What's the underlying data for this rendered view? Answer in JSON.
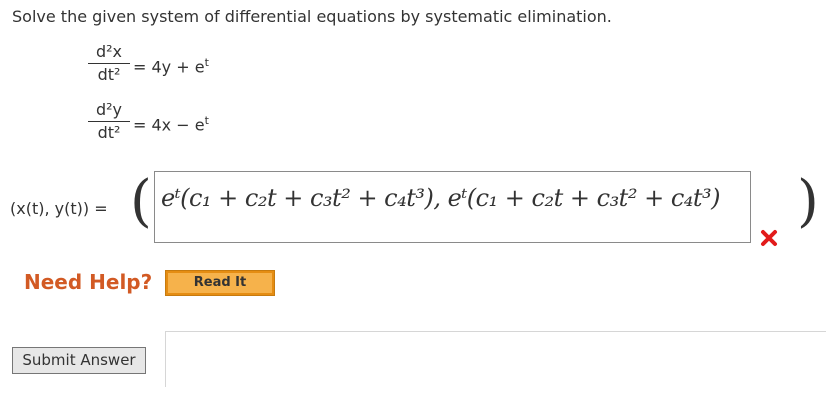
{
  "question": "Solve the given system of differential equations by systematic elimination.",
  "eq1": {
    "num": "d²x",
    "den": "dt²",
    "eq": "=",
    "rhs_a": "4y",
    "op": "+",
    "rhs_b": "e",
    "sup": "t"
  },
  "eq2": {
    "num": "d²y",
    "den": "dt²",
    "eq": "=",
    "rhs_a": "4x",
    "op": "−",
    "rhs_b": "e",
    "sup": "t"
  },
  "answer_label": "(x(t), y(t)) =",
  "answer_value": "eᵗ(c₁ + c₂t + c₃t² + c₄t³), eᵗ(c₁ + c₂t + c₃t² + c₄t³)",
  "status": "incorrect",
  "colors": {
    "accent": "#d25a24",
    "error": "#e21b1b",
    "button": "#f6b24b"
  },
  "need_help": "Need Help?",
  "read_it": "Read It",
  "submit": "Submit Answer"
}
